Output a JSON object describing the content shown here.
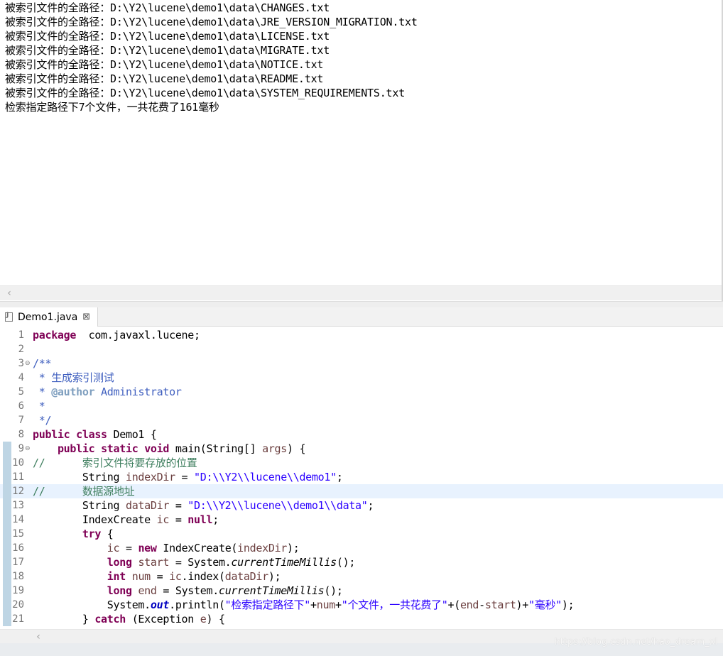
{
  "console": {
    "lines": [
      "被索引文件的全路径：D:\\Y2\\lucene\\demo1\\data\\CHANGES.txt",
      "被索引文件的全路径：D:\\Y2\\lucene\\demo1\\data\\JRE_VERSION_MIGRATION.txt",
      "被索引文件的全路径：D:\\Y2\\lucene\\demo1\\data\\LICENSE.txt",
      "被索引文件的全路径：D:\\Y2\\lucene\\demo1\\data\\MIGRATE.txt",
      "被索引文件的全路径：D:\\Y2\\lucene\\demo1\\data\\NOTICE.txt",
      "被索引文件的全路径：D:\\Y2\\lucene\\demo1\\data\\README.txt",
      "被索引文件的全路径：D:\\Y2\\lucene\\demo1\\data\\SYSTEM_REQUIREMENTS.txt",
      "检索指定路径下7个文件，一共花费了161毫秒"
    ],
    "scroll_left_icon": "chevron-left-icon"
  },
  "editor": {
    "tab": {
      "label": "Demo1.java",
      "close": "⊠",
      "icon": "java-file-icon"
    },
    "current_line": 12,
    "lines": [
      {
        "no": "1",
        "fold": "",
        "diff": false,
        "tokens": [
          [
            "kw",
            "package"
          ],
          [
            "",
            "  com.javaxl.lucene;"
          ]
        ]
      },
      {
        "no": "2",
        "fold": "",
        "diff": false,
        "tokens": []
      },
      {
        "no": "3",
        "fold": "⊖",
        "diff": false,
        "tokens": [
          [
            "cm",
            "/**"
          ]
        ]
      },
      {
        "no": "4",
        "fold": "",
        "diff": false,
        "tokens": [
          [
            "cm",
            " * 生成索引测试"
          ]
        ]
      },
      {
        "no": "5",
        "fold": "",
        "diff": false,
        "tokens": [
          [
            "cm",
            " * "
          ],
          [
            "jd",
            "@author"
          ],
          [
            "cm",
            " Administrator"
          ]
        ]
      },
      {
        "no": "6",
        "fold": "",
        "diff": false,
        "tokens": [
          [
            "cm",
            " *"
          ]
        ]
      },
      {
        "no": "7",
        "fold": "",
        "diff": false,
        "tokens": [
          [
            "cm",
            " */"
          ]
        ]
      },
      {
        "no": "8",
        "fold": "",
        "diff": false,
        "tokens": [
          [
            "kw",
            "public"
          ],
          [
            "",
            " "
          ],
          [
            "kw",
            "class"
          ],
          [
            "",
            " Demo1 {"
          ]
        ]
      },
      {
        "no": "9",
        "fold": "⊖",
        "diff": true,
        "tokens": [
          [
            "",
            "    "
          ],
          [
            "kw",
            "public"
          ],
          [
            "",
            " "
          ],
          [
            "kw",
            "static"
          ],
          [
            "",
            " "
          ],
          [
            "kw",
            "void"
          ],
          [
            "",
            " main(String[] "
          ],
          [
            "vr",
            "args"
          ],
          [
            "",
            ") {"
          ]
        ]
      },
      {
        "no": "10",
        "fold": "",
        "diff": true,
        "tokens": [
          [
            "lc",
            "//      索引文件将要存放的位置"
          ]
        ]
      },
      {
        "no": "11",
        "fold": "",
        "diff": true,
        "tokens": [
          [
            "",
            "        String "
          ],
          [
            "vr",
            "indexDir"
          ],
          [
            "",
            " = "
          ],
          [
            "str",
            "\"D:\\\\Y2\\\\lucene\\\\demo1\""
          ],
          [
            "",
            ";"
          ]
        ]
      },
      {
        "no": "12",
        "fold": "",
        "diff": true,
        "tokens": [
          [
            "lc",
            "//      数据源地址"
          ]
        ]
      },
      {
        "no": "13",
        "fold": "",
        "diff": true,
        "tokens": [
          [
            "",
            "        String "
          ],
          [
            "vr",
            "dataDir"
          ],
          [
            "",
            " = "
          ],
          [
            "str",
            "\"D:\\\\Y2\\\\lucene\\\\demo1\\\\data\""
          ],
          [
            "",
            ";"
          ]
        ]
      },
      {
        "no": "14",
        "fold": "",
        "diff": true,
        "tokens": [
          [
            "",
            "        IndexCreate "
          ],
          [
            "vr",
            "ic"
          ],
          [
            "",
            " = "
          ],
          [
            "kw",
            "null"
          ],
          [
            "",
            ";"
          ]
        ]
      },
      {
        "no": "15",
        "fold": "",
        "diff": true,
        "tokens": [
          [
            "",
            "        "
          ],
          [
            "kw",
            "try"
          ],
          [
            "",
            " {"
          ]
        ]
      },
      {
        "no": "16",
        "fold": "",
        "diff": true,
        "tokens": [
          [
            "",
            "            "
          ],
          [
            "vr",
            "ic"
          ],
          [
            "",
            " = "
          ],
          [
            "kw",
            "new"
          ],
          [
            "",
            " IndexCreate("
          ],
          [
            "vr",
            "indexDir"
          ],
          [
            "",
            ");"
          ]
        ]
      },
      {
        "no": "17",
        "fold": "",
        "diff": true,
        "tokens": [
          [
            "",
            "            "
          ],
          [
            "kw",
            "long"
          ],
          [
            "",
            " "
          ],
          [
            "vr",
            "start"
          ],
          [
            "",
            " = System."
          ],
          [
            "it",
            "currentTimeMillis"
          ],
          [
            "",
            "();"
          ]
        ]
      },
      {
        "no": "18",
        "fold": "",
        "diff": true,
        "tokens": [
          [
            "",
            "            "
          ],
          [
            "kw",
            "int"
          ],
          [
            "",
            " "
          ],
          [
            "vr",
            "num"
          ],
          [
            "",
            " = "
          ],
          [
            "vr",
            "ic"
          ],
          [
            "",
            ".index("
          ],
          [
            "vr",
            "dataDir"
          ],
          [
            "",
            ");"
          ]
        ]
      },
      {
        "no": "19",
        "fold": "",
        "diff": true,
        "tokens": [
          [
            "",
            "            "
          ],
          [
            "kw",
            "long"
          ],
          [
            "",
            " "
          ],
          [
            "vr",
            "end"
          ],
          [
            "",
            " = System."
          ],
          [
            "it",
            "currentTimeMillis"
          ],
          [
            "",
            "();"
          ]
        ]
      },
      {
        "no": "20",
        "fold": "",
        "diff": true,
        "tokens": [
          [
            "",
            "            System."
          ],
          [
            "fld",
            "out"
          ],
          [
            "",
            ".println("
          ],
          [
            "str",
            "\"检索指定路径下\""
          ],
          [
            "",
            "+"
          ],
          [
            "vr",
            "num"
          ],
          [
            "",
            "+"
          ],
          [
            "str",
            "\"个文件，一共花费了\""
          ],
          [
            "",
            "+("
          ],
          [
            "vr",
            "end"
          ],
          [
            "",
            "-"
          ],
          [
            "vr",
            "start"
          ],
          [
            "",
            ")+"
          ],
          [
            "str",
            "\"毫秒\""
          ],
          [
            "",
            ");"
          ]
        ]
      },
      {
        "no": "21",
        "fold": "",
        "diff": true,
        "tokens": [
          [
            "",
            "        } "
          ],
          [
            "kw",
            "catch"
          ],
          [
            "",
            " (Exception "
          ],
          [
            "vr",
            "e"
          ],
          [
            "",
            ") {"
          ]
        ]
      }
    ],
    "scroll_left_icon": "chevron-left-icon"
  },
  "watermark": "https://blog.csdn.net/hao_dream_xl"
}
